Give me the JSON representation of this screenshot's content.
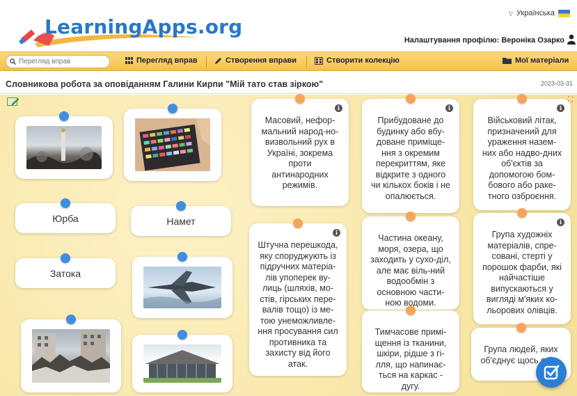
{
  "header": {
    "logo_text": "LearningApps.org",
    "language": "Українська",
    "profile": "Налаштування профілю: Вероніка Озарко"
  },
  "nav": {
    "search_placeholder": "Перегляд вправ",
    "browse": "Перегляд вправ",
    "create": "Створення вправи",
    "collection": "Створити колекцію",
    "my_materials": "Мої матеріали"
  },
  "exercise": {
    "title": "Словникова робота за оповіданням Галини Кирпи \"Мій тато став зіркою\"",
    "date": "2023-03-31"
  },
  "cards": {
    "words": [
      "Юрба",
      "Намет",
      "Затока"
    ],
    "images": [
      {
        "icon": "monument-square-photo"
      },
      {
        "icon": "pastels-photo"
      },
      {
        "icon": "fighter-jet-photo"
      },
      {
        "icon": "barricade-photo"
      },
      {
        "icon": "canopy-house-photo"
      }
    ],
    "definitions": [
      "Масовий, нефор-мальний народ-но-визвольний рух в Україні, зокрема проти антинародних режимів.",
      "Прибудоване до будинку або вбу-доване приміще-ння з окремим перекриттям, яке відкрите з одного чи кількох боків і не опалюється.",
      "Військовий літак, призначений для ураження назем-них або надво-дних об'єктів за допомогою бом-бового або раке-тного озброєння.",
      "Штучна перешкода, яку споруджують із підручних матеріа-лів упоперек ву-лиць (шляхів, мо-стів, гірських пере-валів тощо) із ме-тою унеможливле-ння просування сил противника та захисту від його атак.",
      "Частина океану, моря, озера, що заходить у сухо-діл, але має віль-ний водообмін з основною части-ною водоми.",
      "Група художніх матеріалів, спре-совані, стерті у порошок фарби, які найчастіше випускаються у вигляді м'яких ко-льорових олівців.",
      "Тимчасове примі-щення із тканини, шкіри, рідше з гі-лля, що напинає-ться на каркас - дугу.",
      "Група людей, яких об'єднує щось спіль"
    ]
  },
  "colors": {
    "accent_blue": "#3f8ee0",
    "pin_orange": "#f8a45a",
    "nav_yellow": "#f6c24a",
    "board_bg": "#f8e6a4"
  }
}
